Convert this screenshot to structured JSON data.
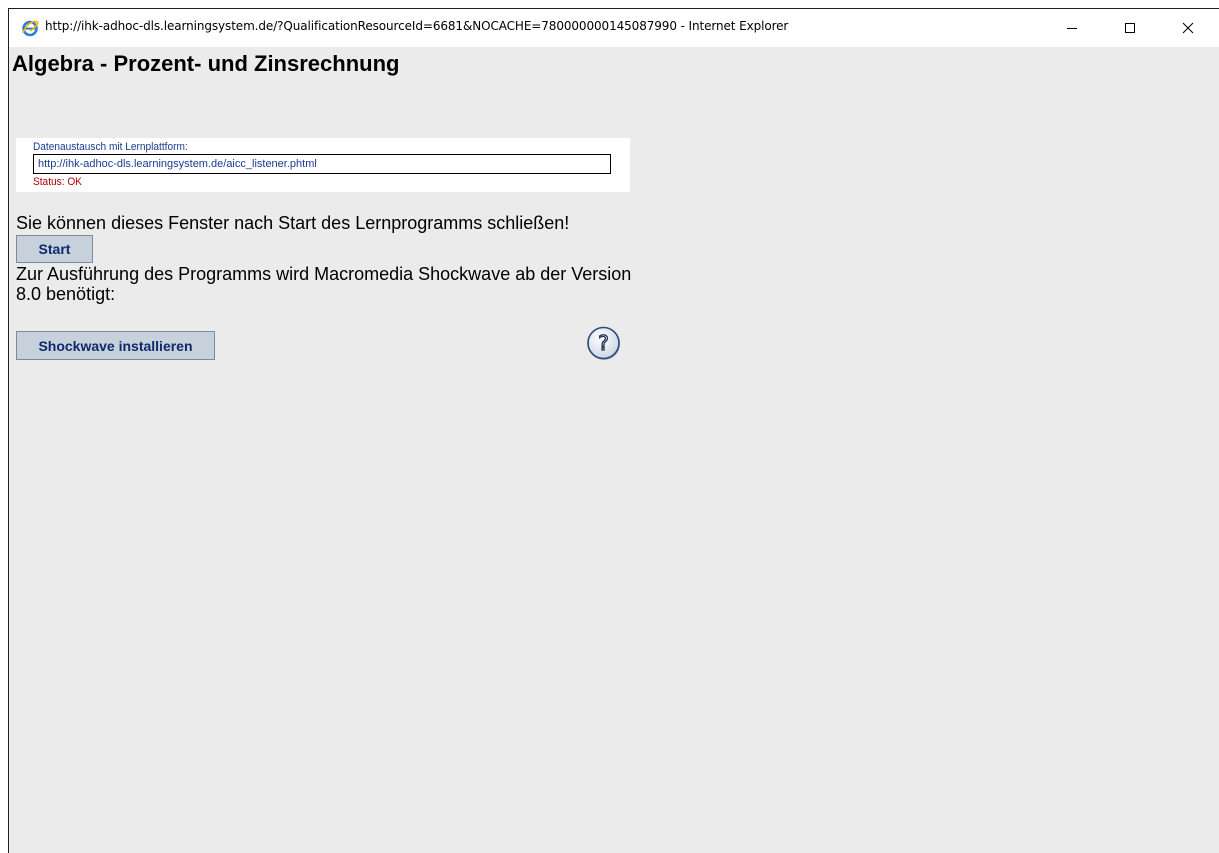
{
  "window": {
    "title": "http://ihk-adhoc-dls.learningsystem.de/?QualificationResourceId=6681&NOCACHE=780000000145087990 - Internet Explorer",
    "icon": "internet-explorer-icon",
    "controls": {
      "minimize_icon": "minimize-icon",
      "maximize_icon": "maximize-icon",
      "close_icon": "close-icon"
    }
  },
  "page": {
    "title": "Algebra - Prozent- und Zinsrechnung"
  },
  "exchange": {
    "label": "Datenaustausch mit Lernplattform:",
    "url": "http://ihk-adhoc-dls.learningsystem.de/aicc_listener.phtml",
    "status": "Status: OK"
  },
  "notice": "Sie können dieses Fenster nach Start des Lernprogramms schließen!",
  "start_button": "Start",
  "requirement": "Zur Ausführung des Programms wird Macromedia Shockwave ab der Version 8.0 benötigt:",
  "shockwave_button": "Shockwave installieren",
  "help": {
    "icon": "help-icon",
    "glyph": "?"
  },
  "colors": {
    "background": "#ebebeb",
    "button_bg": "#c7d1dc",
    "button_text": "#0d2a6b",
    "link_blue": "#1a3b8f",
    "status_red": "#b10000"
  }
}
